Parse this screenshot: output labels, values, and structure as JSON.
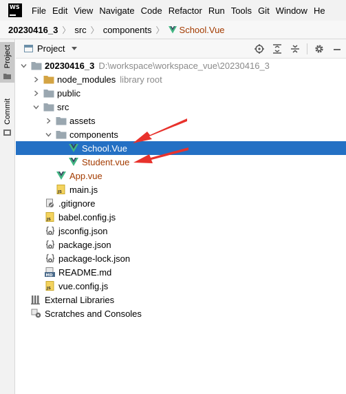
{
  "app": {
    "logo_text": "WS"
  },
  "menu": [
    "File",
    "Edit",
    "View",
    "Navigate",
    "Code",
    "Refactor",
    "Run",
    "Tools",
    "Git",
    "Window",
    "He"
  ],
  "breadcrumb": {
    "root": "20230416_3",
    "src": "src",
    "components": "components",
    "file": "School.Vue"
  },
  "side_tabs": {
    "project": "Project",
    "commit": "Commit"
  },
  "project_panel": {
    "title": "Project"
  },
  "tree": {
    "root": {
      "name": "20230416_3",
      "path": "D:\\workspace\\workspace_vue\\20230416_3"
    },
    "node_modules": {
      "name": "node_modules",
      "note": "library root"
    },
    "public": "public",
    "src": "src",
    "assets": "assets",
    "components": "components",
    "school": "School.Vue",
    "student": "Student.vue",
    "app_vue": "App.vue",
    "main_js": "main.js",
    "gitignore": ".gitignore",
    "babel": "babel.config.js",
    "jsconfig": "jsconfig.json",
    "package": "package.json",
    "package_lock": "package-lock.json",
    "readme": "README.md",
    "vue_config": "vue.config.js",
    "external": "External Libraries",
    "scratches": "Scratches and Consoles"
  },
  "icon_labels": {
    "js": "JS",
    "md": "MD"
  },
  "colors": {
    "selection": "#2470c4",
    "vue_green": "#41b883",
    "folder": "#9aa7b0",
    "arrow": "#e8322c",
    "vue_file_text": "#a33b00"
  }
}
